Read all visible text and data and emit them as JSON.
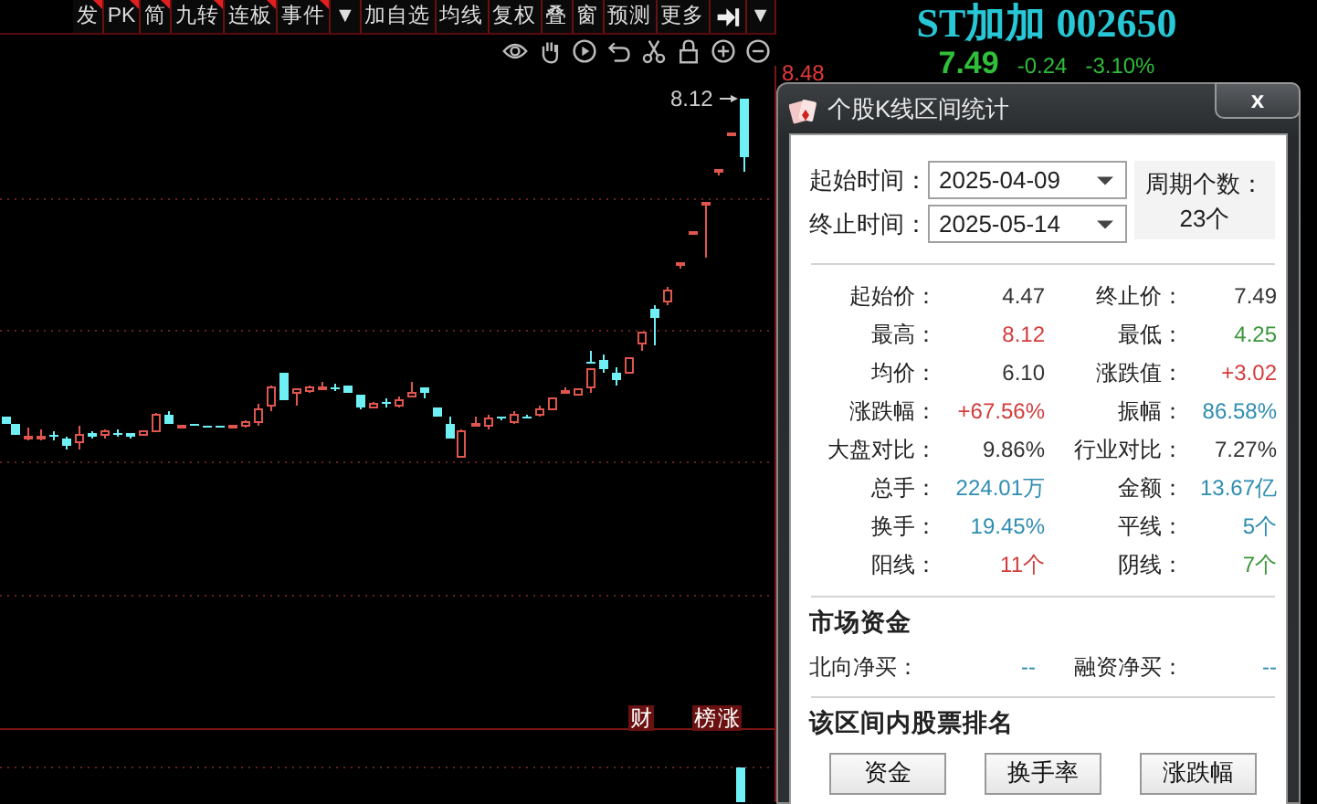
{
  "toolbar": {
    "items": [
      {
        "label": "发",
        "marked": true
      },
      {
        "label": "PK",
        "marked": true
      },
      {
        "label": "简",
        "marked": true
      },
      {
        "label": "九转",
        "marked": true
      },
      {
        "label": "连板",
        "marked": true
      },
      {
        "label": "事件",
        "marked": true
      },
      {
        "label": "▼",
        "marked": false
      },
      {
        "label": "加自选",
        "marked": false
      },
      {
        "label": "均线",
        "marked": false
      },
      {
        "label": "复权",
        "marked": false
      },
      {
        "label": "叠",
        "marked": false
      },
      {
        "label": "窗",
        "marked": false
      },
      {
        "label": "预测",
        "marked": false
      },
      {
        "label": "更多",
        "marked": false
      }
    ],
    "end_dropdown": "▼"
  },
  "chart": {
    "high_label": "8.12",
    "signals": [
      "财",
      "榜",
      "涨"
    ]
  },
  "quote": {
    "name": "ST加加",
    "code": "002650",
    "axis_label": "8.48",
    "price": "7.49",
    "change": "-0.24",
    "change_pct": "-3.10%"
  },
  "dialog": {
    "title": "个股K线区间统计",
    "close": "x",
    "start": {
      "label": "起始时间：",
      "value": "2025-04-09"
    },
    "end": {
      "label": "终止时间：",
      "value": "2025-05-14"
    },
    "period": {
      "label": "周期个数：",
      "value": "23个"
    },
    "stats": [
      {
        "label": "起始价：",
        "value": "4.47",
        "color": "#333333"
      },
      {
        "label": "终止价：",
        "value": "7.49",
        "color": "#333333"
      },
      {
        "label": "最高：",
        "value": "8.12",
        "color": "#d23c3c"
      },
      {
        "label": "最低：",
        "value": "4.25",
        "color": "#3a963a"
      },
      {
        "label": "均价：",
        "value": "6.10",
        "color": "#333333"
      },
      {
        "label": "涨跌值：",
        "value": "+3.02",
        "color": "#d23c3c"
      },
      {
        "label": "涨跌幅：",
        "value": "+67.56%",
        "color": "#d23c3c"
      },
      {
        "label": "振幅：",
        "value": "86.58%",
        "color": "#2f8db0"
      },
      {
        "label": "大盘对比：",
        "value": "9.86%",
        "color": "#333333"
      },
      {
        "label": "行业对比：",
        "value": "7.27%",
        "color": "#333333"
      },
      {
        "label": "总手：",
        "value": "224.01万",
        "color": "#2f8db0"
      },
      {
        "label": "金额：",
        "value": "13.67亿",
        "color": "#2f8db0"
      },
      {
        "label": "换手：",
        "value": "19.45%",
        "color": "#2f8db0"
      },
      {
        "label": "平线：",
        "value": "5个",
        "color": "#2f8db0"
      },
      {
        "label": "阳线：",
        "value": "11个",
        "color": "#d23c3c"
      },
      {
        "label": "阴线：",
        "value": "7个",
        "color": "#3a963a"
      }
    ],
    "market": {
      "title": "市场资金",
      "items": [
        {
          "label": "北向净买：",
          "value": "--"
        },
        {
          "label": "融资净买：",
          "value": "--"
        }
      ]
    },
    "ranking": {
      "title": "该区间内股票排名",
      "buttons": [
        "资金",
        "换手率",
        "涨跌幅"
      ]
    }
  }
}
